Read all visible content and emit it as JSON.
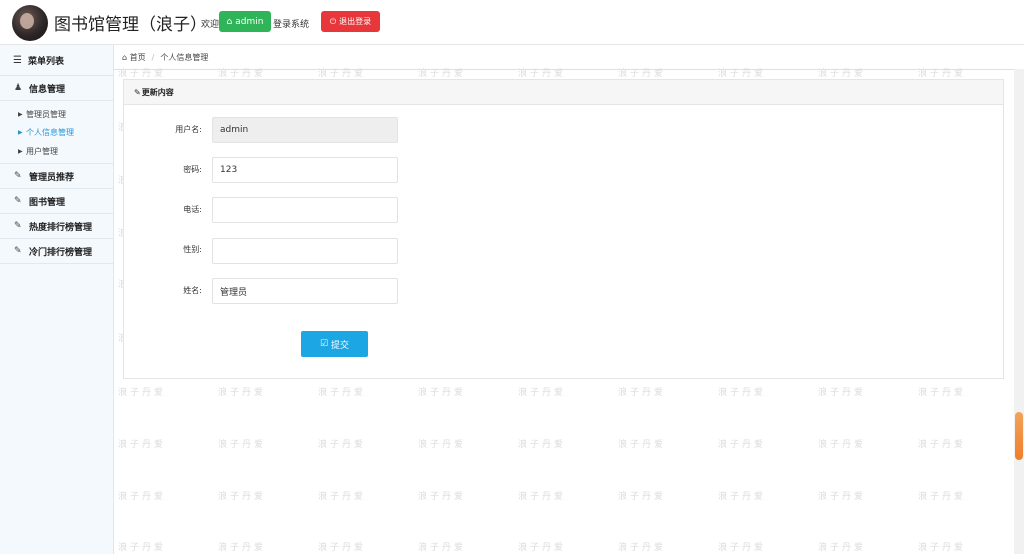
{
  "header": {
    "app_title": "图书馆管理（浪子）",
    "welcome_text": "欢迎",
    "user_button": "admin",
    "after_user_text": "登录系统",
    "logout_button": "退出登录"
  },
  "sidebar": {
    "menu_title": "菜单列表",
    "info_group": "信息管理",
    "sub_items": [
      {
        "label": "管理员管理"
      },
      {
        "label": "个人信息管理"
      },
      {
        "label": "用户管理"
      }
    ],
    "groups": [
      {
        "label": "管理员推荐"
      },
      {
        "label": "图书管理"
      },
      {
        "label": "热度排行榜管理"
      },
      {
        "label": "冷门排行榜管理"
      }
    ]
  },
  "breadcrumb": {
    "home": "首页",
    "current": "个人信息管理"
  },
  "panel": {
    "title": "更新内容"
  },
  "form": {
    "username_label": "用户名:",
    "username_value": "admin",
    "password_label": "密码:",
    "password_value": "123",
    "phone_label": "电话:",
    "phone_value": "",
    "gender_label": "性别:",
    "gender_value": "",
    "name_label": "姓名:",
    "name_value": "管理员",
    "submit_label": "提交"
  },
  "watermark": "浪子丹爱",
  "colors": {
    "user_button": "#2fb45a",
    "logout_button": "#e8373b",
    "submit_button": "#1ca6e4",
    "active_link": "#2a93d5",
    "sidebar_bg": "#f4f9fd"
  },
  "icons": {
    "user_button": "home-icon",
    "logout_button": "power-icon",
    "menu_title": "list-icon",
    "info_group": "user-icon",
    "groups": "edit-icon",
    "breadcrumb_home": "home-icon",
    "submit": "checkbox-icon",
    "panel_title": "edit-icon"
  }
}
